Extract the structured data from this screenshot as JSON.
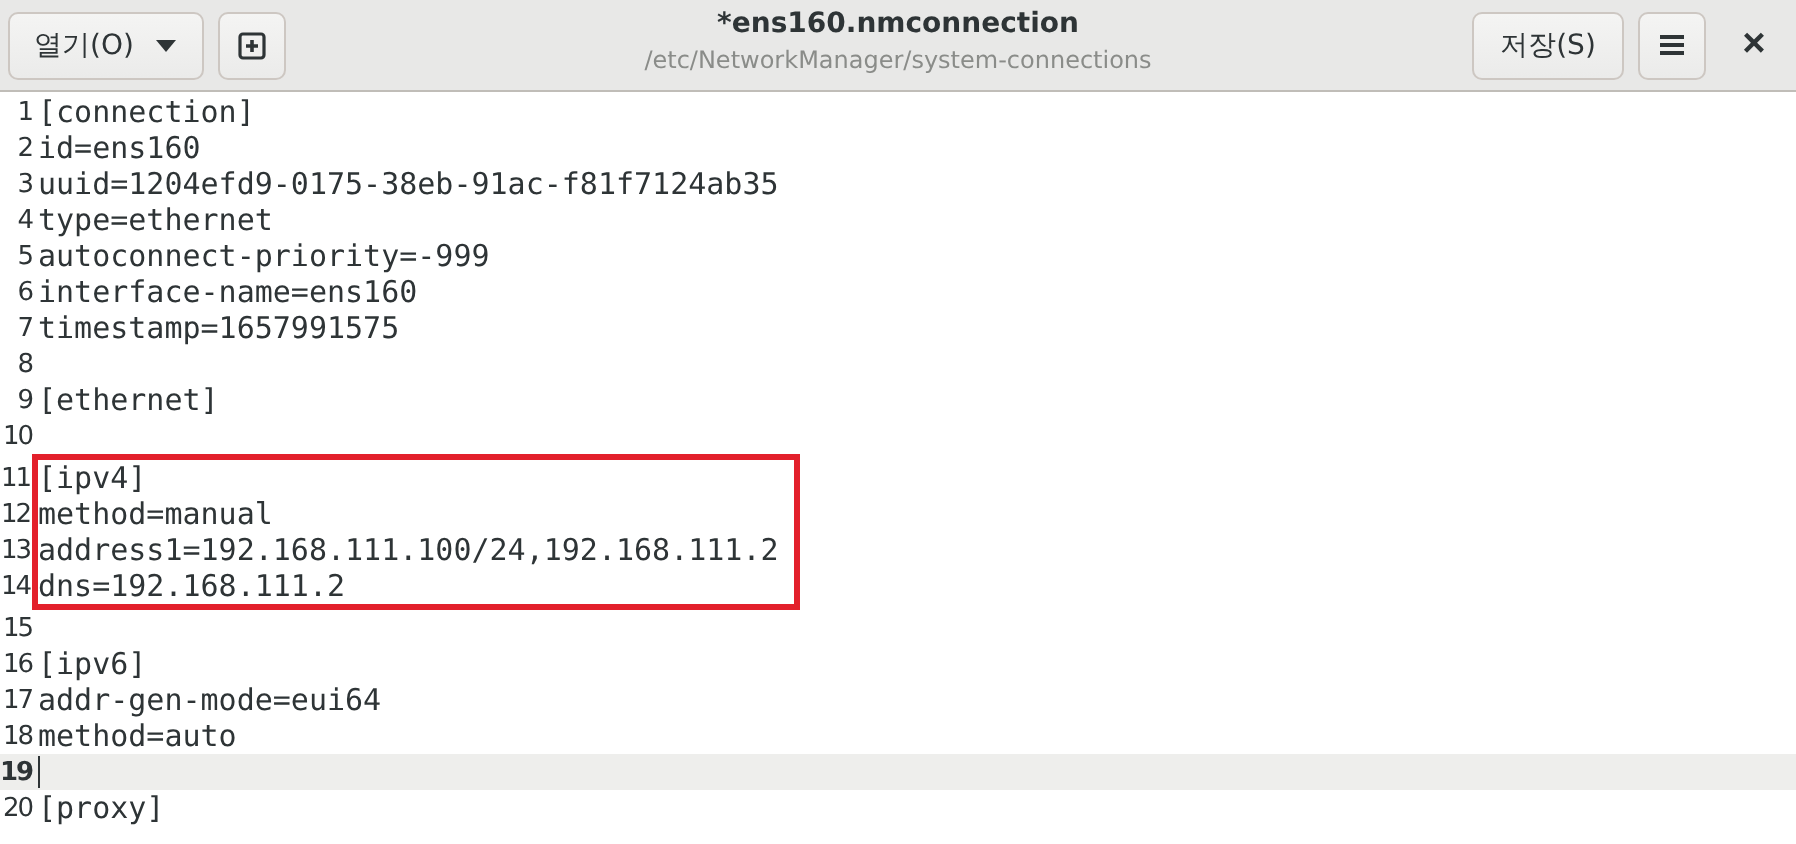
{
  "header": {
    "open_button": "열기(O)",
    "title": "*ens160.nmconnection",
    "subtitle": "/etc/NetworkManager/system-connections",
    "save_button": "저장(S)",
    "close": "×"
  },
  "lines": [
    {
      "number": "1",
      "text": "[connection]",
      "current": false,
      "boxed": false
    },
    {
      "number": "2",
      "text": "id=ens160",
      "current": false,
      "boxed": false
    },
    {
      "number": "3",
      "text": "uuid=1204efd9-0175-38eb-91ac-f81f7124ab35",
      "current": false,
      "boxed": false
    },
    {
      "number": "4",
      "text": "type=ethernet",
      "current": false,
      "boxed": false
    },
    {
      "number": "5",
      "text": "autoconnect-priority=-999",
      "current": false,
      "boxed": false
    },
    {
      "number": "6",
      "text": "interface-name=ens160",
      "current": false,
      "boxed": false
    },
    {
      "number": "7",
      "text": "timestamp=1657991575",
      "current": false,
      "boxed": false
    },
    {
      "number": "8",
      "current": false,
      "boxed": false
    },
    {
      "number": "9",
      "text": "[ethernet]",
      "current": false,
      "boxed": false
    },
    {
      "number": "10",
      "current": false,
      "boxed": false
    },
    {
      "number": "11",
      "text": "[ipv4]",
      "current": false,
      "boxed": true
    },
    {
      "number": "12",
      "text": "method=manual",
      "current": false,
      "boxed": true
    },
    {
      "number": "13",
      "text": "address1=192.168.111.100/24,192.168.111.2",
      "current": false,
      "boxed": true
    },
    {
      "number": "14",
      "text": "dns=192.168.111.2",
      "current": false,
      "boxed": true
    },
    {
      "number": "15",
      "current": false,
      "boxed": false
    },
    {
      "number": "16",
      "text": "[ipv6]",
      "current": false,
      "boxed": false
    },
    {
      "number": "17",
      "text": "addr-gen-mode=eui64",
      "current": false,
      "boxed": false
    },
    {
      "number": "18",
      "text": "method=auto",
      "current": false,
      "boxed": false
    },
    {
      "number": "19",
      "current": true,
      "boxed": false
    },
    {
      "number": "20",
      "text": "[proxy]",
      "current": false,
      "boxed": false
    }
  ]
}
